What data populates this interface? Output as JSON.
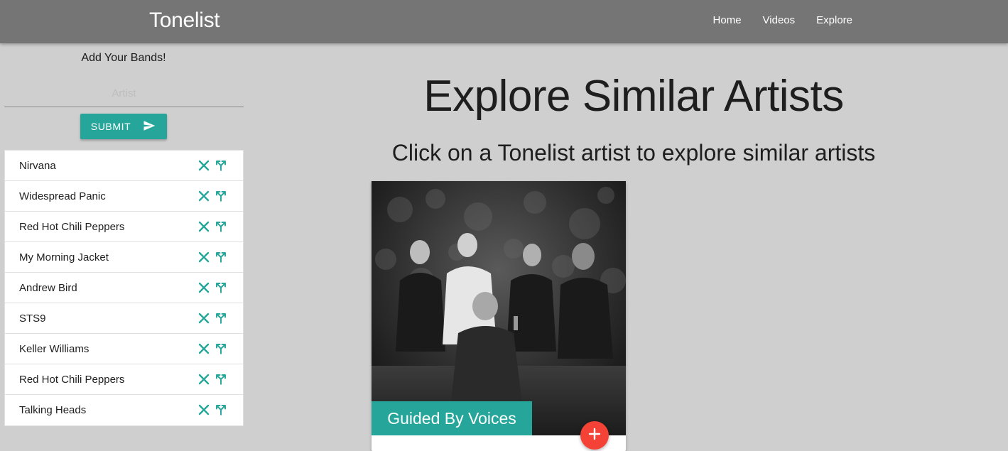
{
  "navbar": {
    "brand": "Tonelist",
    "links": [
      {
        "label": "Home"
      },
      {
        "label": "Videos"
      },
      {
        "label": "Explore"
      }
    ]
  },
  "sidebar": {
    "title": "Add Your Bands!",
    "input": {
      "placeholder": "Artist",
      "value": ""
    },
    "submit_label": "SUBMIT",
    "bands": [
      {
        "name": "Nirvana"
      },
      {
        "name": "Widespread Panic"
      },
      {
        "name": "Red Hot Chili Peppers"
      },
      {
        "name": "My Morning Jacket"
      },
      {
        "name": "Andrew Bird"
      },
      {
        "name": "STS9"
      },
      {
        "name": "Keller Williams"
      },
      {
        "name": "Red Hot Chili Peppers"
      },
      {
        "name": "Talking Heads"
      }
    ],
    "band_actions": [
      "close-icon",
      "call-split-icon"
    ]
  },
  "main": {
    "title": "Explore Similar Artists",
    "subtitle": "Click on a Tonelist artist to explore similar artists",
    "artist_card": {
      "name": "Guided By Voices",
      "fab_icon": "add-icon"
    }
  },
  "colors": {
    "navbar": "#757575",
    "background": "#cfcfcf",
    "accent_teal": "#26a69a",
    "fab_red": "#f44336"
  }
}
